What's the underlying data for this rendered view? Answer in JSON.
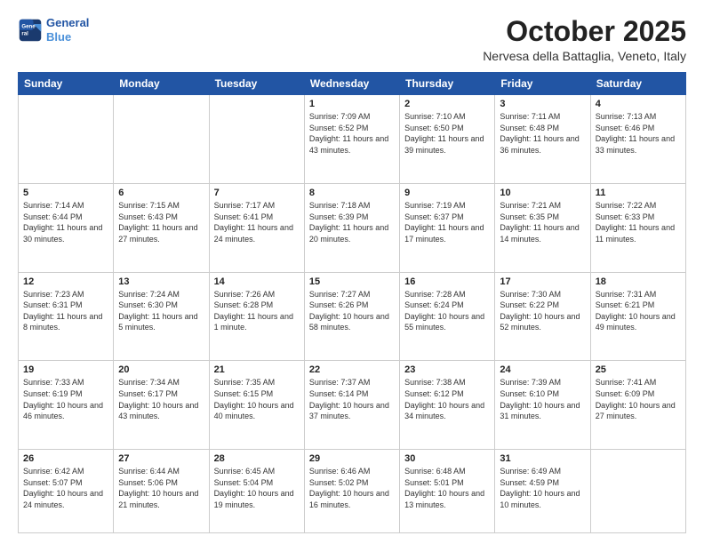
{
  "header": {
    "logo_line1": "General",
    "logo_line2": "Blue",
    "month_title": "October 2025",
    "location": "Nervesa della Battaglia, Veneto, Italy"
  },
  "weekdays": [
    "Sunday",
    "Monday",
    "Tuesday",
    "Wednesday",
    "Thursday",
    "Friday",
    "Saturday"
  ],
  "weeks": [
    [
      {
        "day": "",
        "info": ""
      },
      {
        "day": "",
        "info": ""
      },
      {
        "day": "",
        "info": ""
      },
      {
        "day": "1",
        "info": "Sunrise: 7:09 AM\nSunset: 6:52 PM\nDaylight: 11 hours and 43 minutes."
      },
      {
        "day": "2",
        "info": "Sunrise: 7:10 AM\nSunset: 6:50 PM\nDaylight: 11 hours and 39 minutes."
      },
      {
        "day": "3",
        "info": "Sunrise: 7:11 AM\nSunset: 6:48 PM\nDaylight: 11 hours and 36 minutes."
      },
      {
        "day": "4",
        "info": "Sunrise: 7:13 AM\nSunset: 6:46 PM\nDaylight: 11 hours and 33 minutes."
      }
    ],
    [
      {
        "day": "5",
        "info": "Sunrise: 7:14 AM\nSunset: 6:44 PM\nDaylight: 11 hours and 30 minutes."
      },
      {
        "day": "6",
        "info": "Sunrise: 7:15 AM\nSunset: 6:43 PM\nDaylight: 11 hours and 27 minutes."
      },
      {
        "day": "7",
        "info": "Sunrise: 7:17 AM\nSunset: 6:41 PM\nDaylight: 11 hours and 24 minutes."
      },
      {
        "day": "8",
        "info": "Sunrise: 7:18 AM\nSunset: 6:39 PM\nDaylight: 11 hours and 20 minutes."
      },
      {
        "day": "9",
        "info": "Sunrise: 7:19 AM\nSunset: 6:37 PM\nDaylight: 11 hours and 17 minutes."
      },
      {
        "day": "10",
        "info": "Sunrise: 7:21 AM\nSunset: 6:35 PM\nDaylight: 11 hours and 14 minutes."
      },
      {
        "day": "11",
        "info": "Sunrise: 7:22 AM\nSunset: 6:33 PM\nDaylight: 11 hours and 11 minutes."
      }
    ],
    [
      {
        "day": "12",
        "info": "Sunrise: 7:23 AM\nSunset: 6:31 PM\nDaylight: 11 hours and 8 minutes."
      },
      {
        "day": "13",
        "info": "Sunrise: 7:24 AM\nSunset: 6:30 PM\nDaylight: 11 hours and 5 minutes."
      },
      {
        "day": "14",
        "info": "Sunrise: 7:26 AM\nSunset: 6:28 PM\nDaylight: 11 hours and 1 minute."
      },
      {
        "day": "15",
        "info": "Sunrise: 7:27 AM\nSunset: 6:26 PM\nDaylight: 10 hours and 58 minutes."
      },
      {
        "day": "16",
        "info": "Sunrise: 7:28 AM\nSunset: 6:24 PM\nDaylight: 10 hours and 55 minutes."
      },
      {
        "day": "17",
        "info": "Sunrise: 7:30 AM\nSunset: 6:22 PM\nDaylight: 10 hours and 52 minutes."
      },
      {
        "day": "18",
        "info": "Sunrise: 7:31 AM\nSunset: 6:21 PM\nDaylight: 10 hours and 49 minutes."
      }
    ],
    [
      {
        "day": "19",
        "info": "Sunrise: 7:33 AM\nSunset: 6:19 PM\nDaylight: 10 hours and 46 minutes."
      },
      {
        "day": "20",
        "info": "Sunrise: 7:34 AM\nSunset: 6:17 PM\nDaylight: 10 hours and 43 minutes."
      },
      {
        "day": "21",
        "info": "Sunrise: 7:35 AM\nSunset: 6:15 PM\nDaylight: 10 hours and 40 minutes."
      },
      {
        "day": "22",
        "info": "Sunrise: 7:37 AM\nSunset: 6:14 PM\nDaylight: 10 hours and 37 minutes."
      },
      {
        "day": "23",
        "info": "Sunrise: 7:38 AM\nSunset: 6:12 PM\nDaylight: 10 hours and 34 minutes."
      },
      {
        "day": "24",
        "info": "Sunrise: 7:39 AM\nSunset: 6:10 PM\nDaylight: 10 hours and 31 minutes."
      },
      {
        "day": "25",
        "info": "Sunrise: 7:41 AM\nSunset: 6:09 PM\nDaylight: 10 hours and 27 minutes."
      }
    ],
    [
      {
        "day": "26",
        "info": "Sunrise: 6:42 AM\nSunset: 5:07 PM\nDaylight: 10 hours and 24 minutes."
      },
      {
        "day": "27",
        "info": "Sunrise: 6:44 AM\nSunset: 5:06 PM\nDaylight: 10 hours and 21 minutes."
      },
      {
        "day": "28",
        "info": "Sunrise: 6:45 AM\nSunset: 5:04 PM\nDaylight: 10 hours and 19 minutes."
      },
      {
        "day": "29",
        "info": "Sunrise: 6:46 AM\nSunset: 5:02 PM\nDaylight: 10 hours and 16 minutes."
      },
      {
        "day": "30",
        "info": "Sunrise: 6:48 AM\nSunset: 5:01 PM\nDaylight: 10 hours and 13 minutes."
      },
      {
        "day": "31",
        "info": "Sunrise: 6:49 AM\nSunset: 4:59 PM\nDaylight: 10 hours and 10 minutes."
      },
      {
        "day": "",
        "info": ""
      }
    ]
  ]
}
